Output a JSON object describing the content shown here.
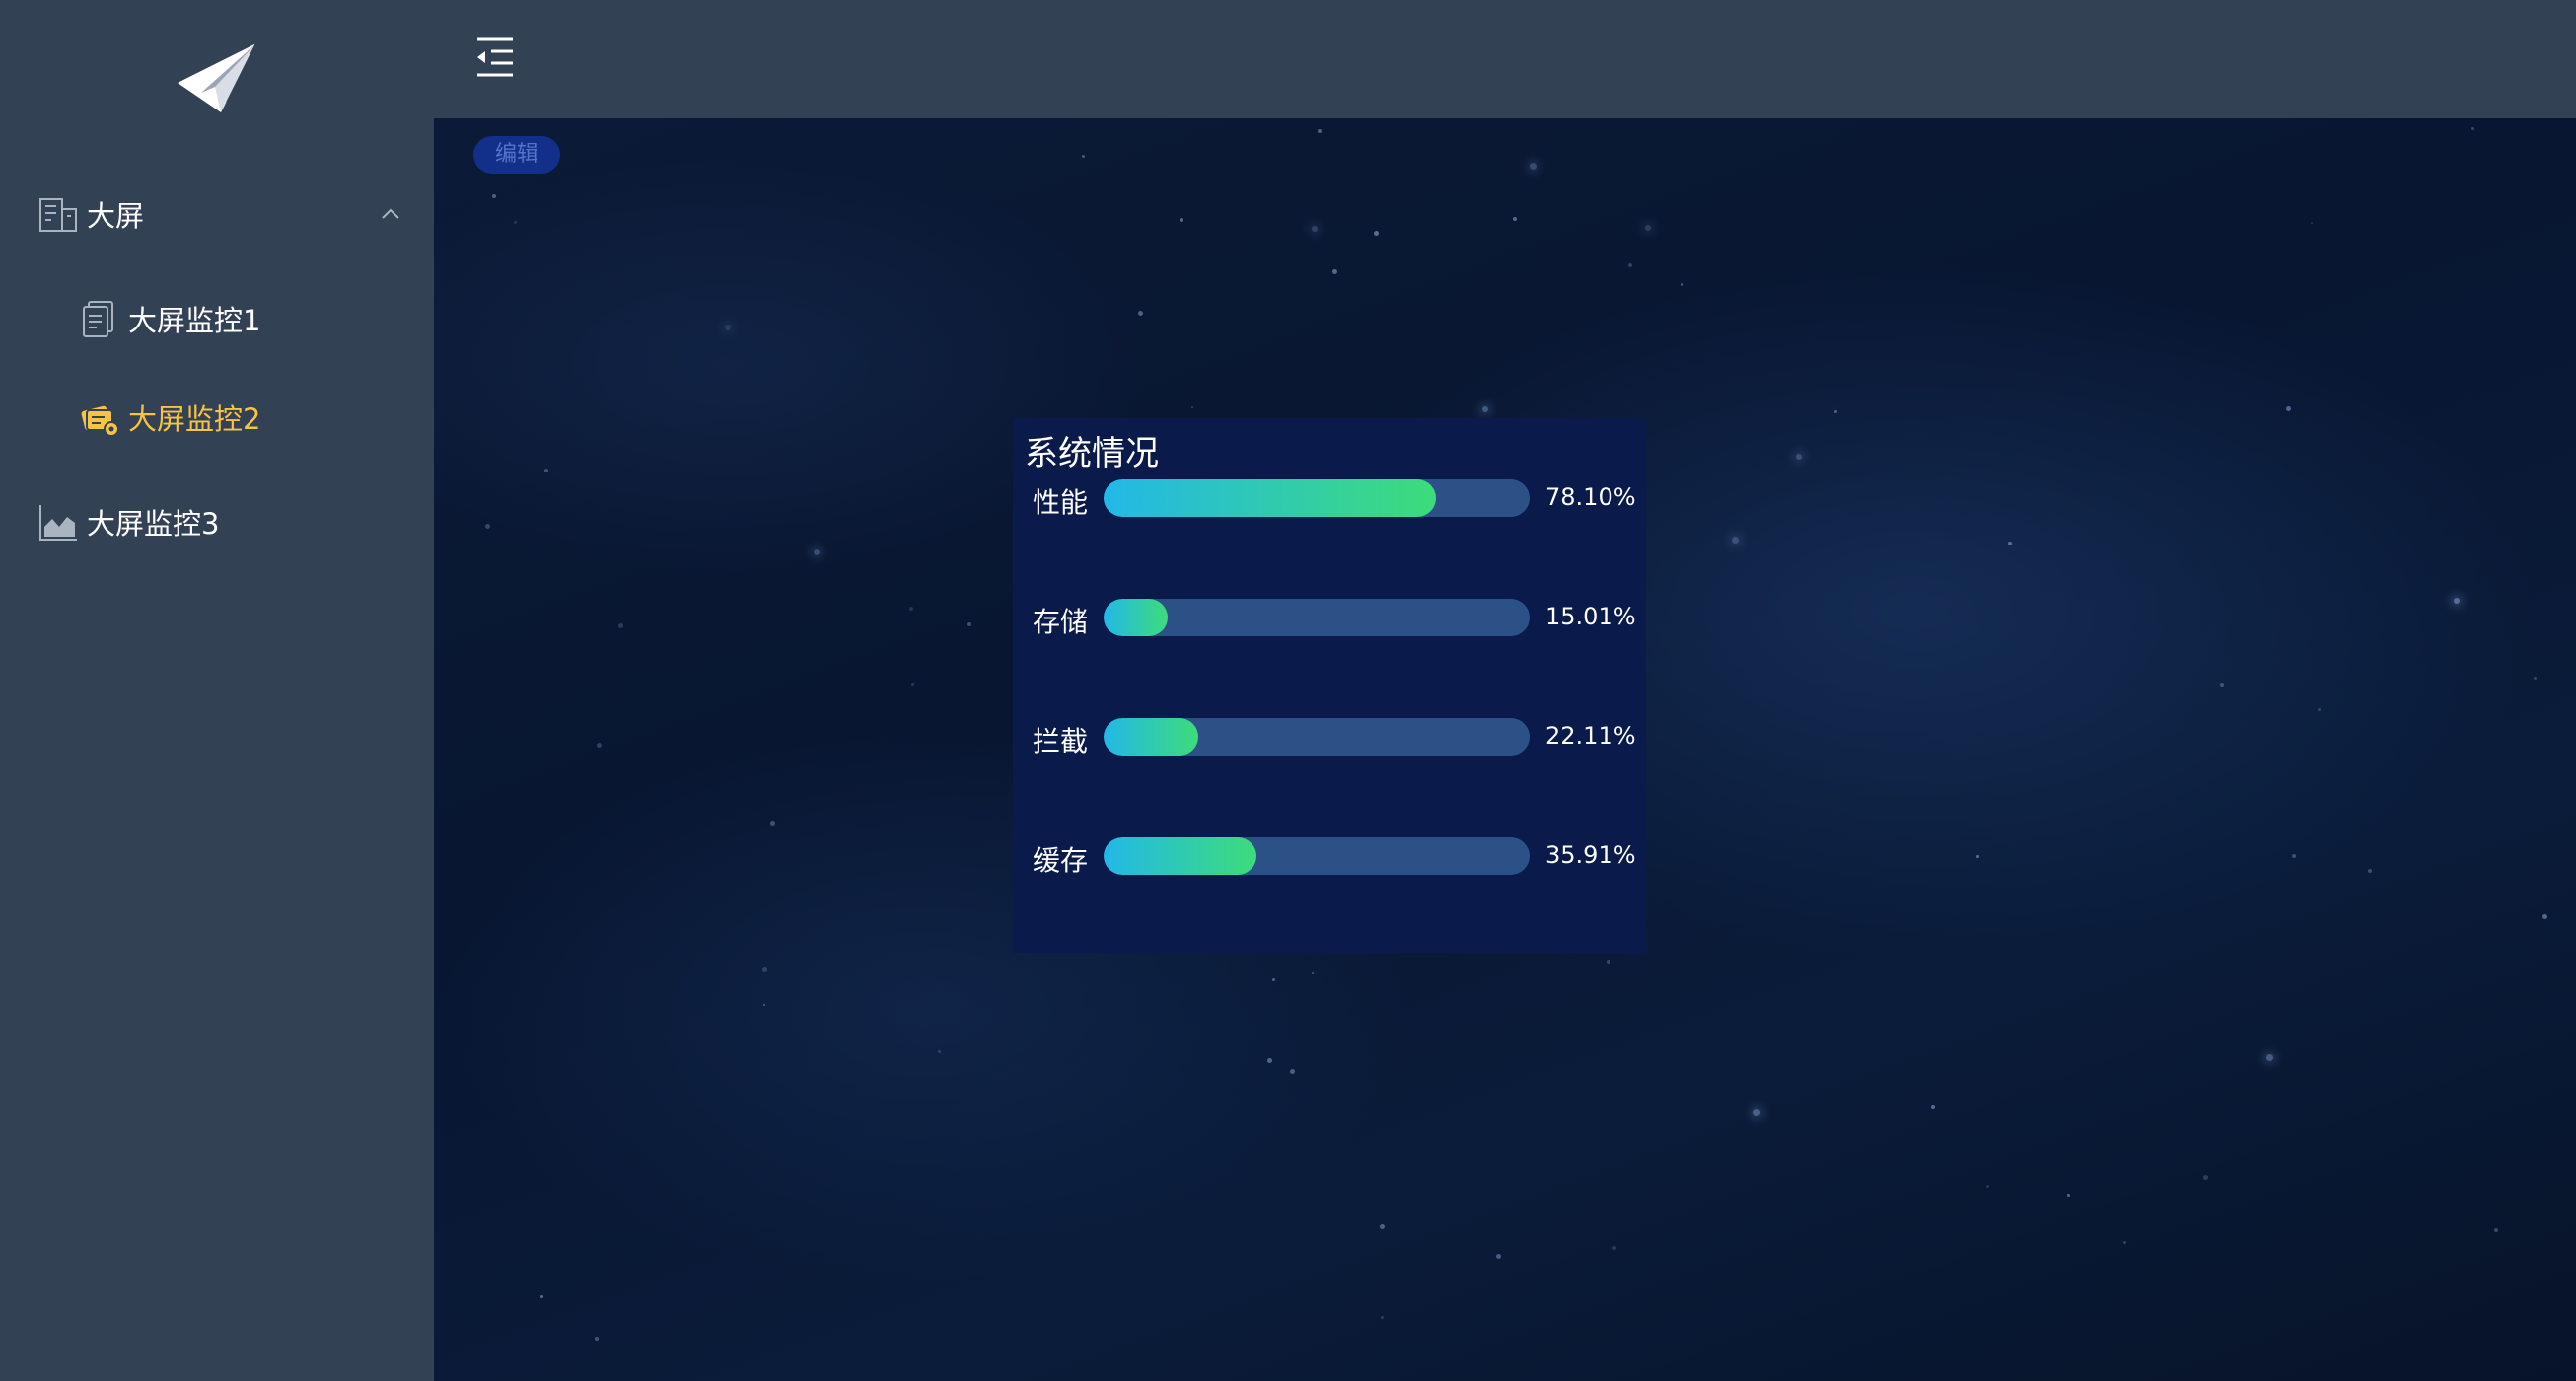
{
  "sidebar": {
    "menu": {
      "group_label": "大屏",
      "sub1_label": "大屏监控1",
      "sub2_label": "大屏监控2",
      "item3_label": "大屏监控3"
    },
    "active_color": "#f6c342"
  },
  "main": {
    "edit_label": "编辑",
    "panel": {
      "title": "系统情况",
      "rows": [
        {
          "label": "性能",
          "value": "78.10%",
          "fraction": 0.781
        },
        {
          "label": "存储",
          "value": "15.01%",
          "fraction": 0.1501
        },
        {
          "label": "拦截",
          "value": "22.11%",
          "fraction": 0.2211
        },
        {
          "label": "缓存",
          "value": "35.91%",
          "fraction": 0.3591
        }
      ]
    }
  },
  "icons": {
    "logo": "paper-plane-icon",
    "fold": "menu-fold-icon",
    "group": "building-icon",
    "sub1": "document-icon",
    "sub2": "cards-icon",
    "item3": "area-chart-icon",
    "chevron": "chevron-up-icon"
  }
}
